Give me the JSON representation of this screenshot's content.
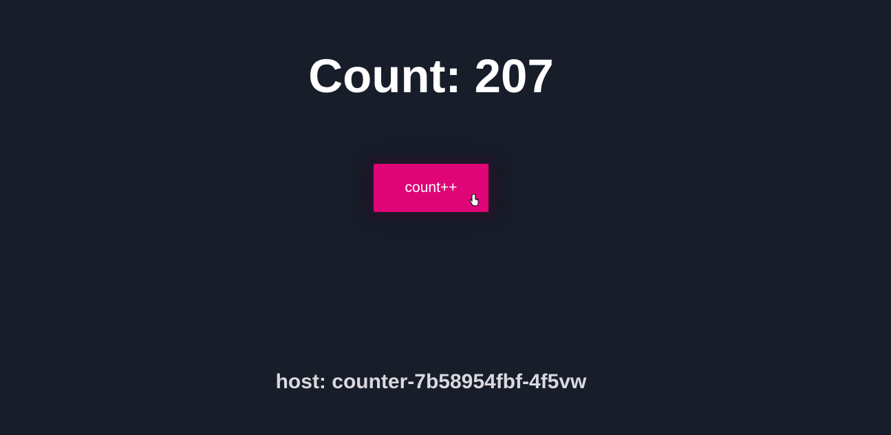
{
  "heading": {
    "text": "Count: 207"
  },
  "button": {
    "label": "count++"
  },
  "footer": {
    "host": "host: counter-7b58954fbf-4f5vw"
  },
  "colors": {
    "background": "#181d2a",
    "accent": "#df0577",
    "text": "#ffffff",
    "muted_text": "#d9d9de"
  }
}
